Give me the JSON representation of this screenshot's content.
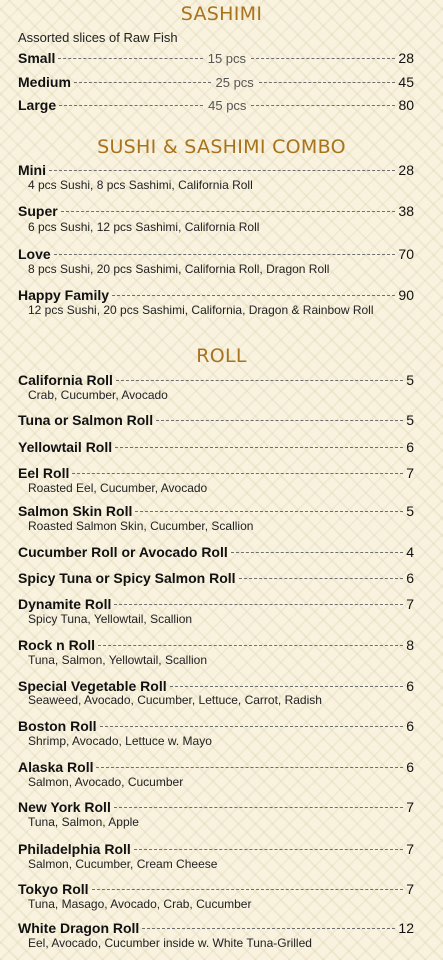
{
  "sashimi": {
    "title": "SASHIMI",
    "note": "Assorted slices of Raw Fish",
    "items": [
      {
        "name": "Small",
        "qty": "15 pcs",
        "price": "28"
      },
      {
        "name": "Medium",
        "qty": "25 pcs",
        "price": "45"
      },
      {
        "name": "Large",
        "qty": "45 pcs",
        "price": "80"
      }
    ]
  },
  "combo": {
    "title": "SUSHI & SASHIMI COMBO",
    "items": [
      {
        "name": "Mini",
        "price": "28",
        "desc": "4 pcs Sushi, 8 pcs Sashimi, California Roll"
      },
      {
        "name": "Super",
        "price": "38",
        "desc": "6 pcs Sushi, 12 pcs Sashimi, California Roll"
      },
      {
        "name": "Love",
        "price": "70",
        "desc": "8 pcs Sushi, 20 pcs Sashimi, California Roll, Dragon Roll"
      },
      {
        "name": "Happy Family",
        "price": "90",
        "desc": "12 pcs Sushi, 20 pcs Sashimi, California, Dragon & Rainbow Roll"
      }
    ]
  },
  "roll": {
    "title": "ROLL",
    "items": [
      {
        "name": "California Roll",
        "price": "5",
        "desc": "Crab, Cucumber, Avocado"
      },
      {
        "name": "Tuna or Salmon Roll",
        "price": "5",
        "desc": ""
      },
      {
        "name": "Yellowtail Roll",
        "price": "6",
        "desc": ""
      },
      {
        "name": "Eel Roll",
        "price": "7",
        "desc": "Roasted Eel, Cucumber, Avocado"
      },
      {
        "name": "Salmon Skin Roll",
        "price": "5",
        "desc": "Roasted Salmon Skin, Cucumber, Scallion"
      },
      {
        "name": "Cucumber Roll or Avocado Roll",
        "price": "4",
        "desc": ""
      },
      {
        "name": "Spicy Tuna or Spicy Salmon Roll",
        "price": "6",
        "desc": ""
      },
      {
        "name": "Dynamite Roll",
        "price": "7",
        "desc": "Spicy Tuna, Yellowtail, Scallion"
      },
      {
        "name": "Rock n Roll",
        "price": "8",
        "desc": "Tuna, Salmon, Yellowtail, Scallion"
      },
      {
        "name": "Special Vegetable Roll",
        "price": "6",
        "desc": "Seaweed, Avocado,  Cucumber, Lettuce, Carrot, Radish"
      },
      {
        "name": "Boston Roll",
        "price": "6",
        "desc": "Shrimp, Avocado, Lettuce w. Mayo"
      },
      {
        "name": "Alaska Roll",
        "price": "6",
        "desc": "Salmon, Avocado, Cucumber"
      },
      {
        "name": "New York Roll",
        "price": "7",
        "desc": "Tuna, Salmon, Apple"
      },
      {
        "name": "Philadelphia Roll",
        "price": "7",
        "desc": "Salmon, Cucumber, Cream Cheese"
      },
      {
        "name": "Tokyo Roll",
        "price": "7",
        "desc": "Tuna, Masago, Avocado, Crab, Cucumber"
      },
      {
        "name": "White Dragon Roll",
        "price": "12",
        "desc": "Eel, Avocado, Cucumber inside w. White Tuna-Grilled"
      }
    ]
  }
}
